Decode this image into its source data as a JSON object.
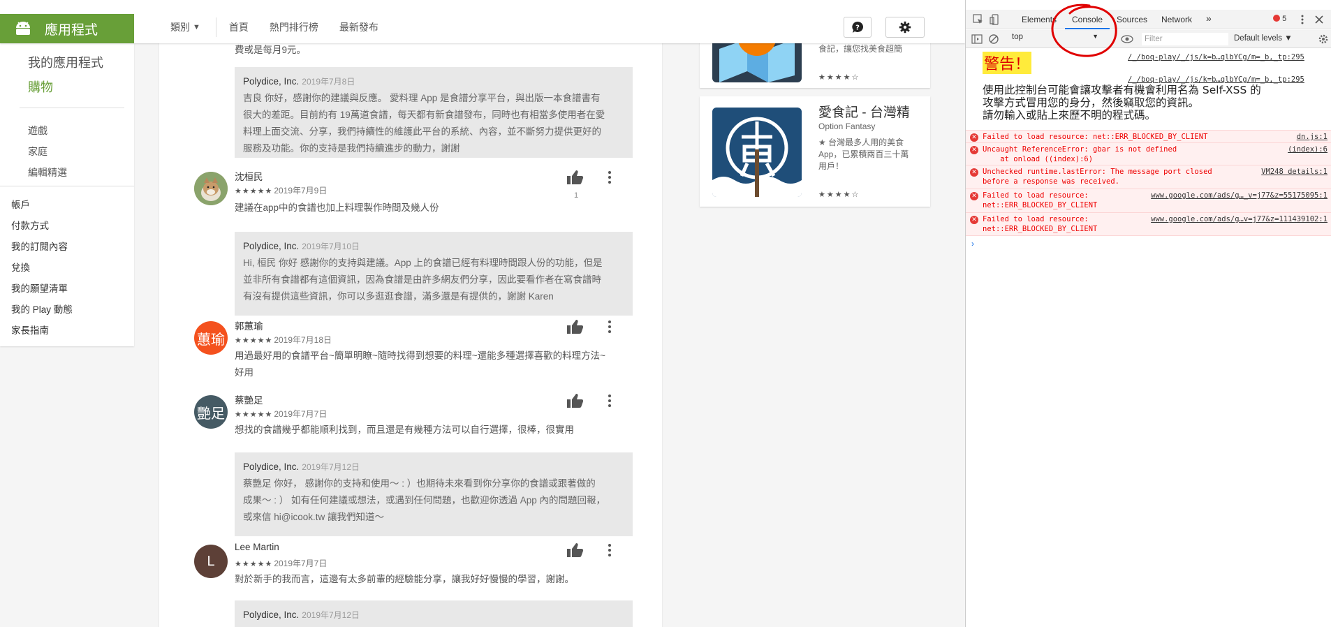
{
  "play": {
    "brand": "應用程式",
    "topnav": {
      "category": "類別",
      "home": "首頁",
      "top_charts": "熱門排行榜",
      "new_releases": "最新發布"
    },
    "sidenav": {
      "my_apps": "我的應用程式",
      "shop": "購物",
      "subs": [
        "遊戲",
        "家庭",
        "編輯精選"
      ],
      "account": [
        "帳戶",
        "付款方式",
        "我的訂閱內容",
        "兌換",
        "我的願望清單",
        "我的 Play 動態",
        "家長指南"
      ]
    },
    "top_fragment": "費或是每月9元。",
    "reviews": [
      {
        "reply_only": true,
        "reply": {
          "author": "Polydice, Inc.",
          "date": "2019年7月8日",
          "lines": [
            "吉良 你好，感謝你的建議與反應。 愛料理 App 是食譜分享平台，與出版一本食譜書有",
            "很大的差距。目前約有 19萬道食譜，每天都有新食譜發布，同時也有相當多使用者在愛",
            "料理上面交流、分享，我們持續性的維護此平台的系統、內容，並不斷努力提供更好的",
            "服務及功能。你的支持是我們持續進步的動力，謝謝"
          ]
        }
      },
      {
        "name": "沈桓民",
        "stars": "★★★★★",
        "date": "2019年7月9日",
        "likes": "1",
        "body": [
          "建議在app中的食譜也加上料理製作時間及幾人份"
        ],
        "reply": {
          "author": "Polydice, Inc.",
          "date": "2019年7月10日",
          "lines": [
            "Hi, 桓民 你好 感謝你的支持與建議。App 上的食譜已經有料理時間跟人份的功能，但是",
            "並非所有食譜都有這個資訊，因為食譜是由許多網友們分享，因此要看作者在寫食譜時",
            "有沒有提供這些資訊，你可以多逛逛食譜，滿多還是有提供的，謝謝 Karen"
          ]
        }
      },
      {
        "name": "郭蕙瑜",
        "avatar_text": "蕙瑜",
        "stars": "★★★★★",
        "date": "2019年7月18日",
        "body": [
          "用過最好用的食譜平台~簡單明瞭~隨時找得到想要的料理~還能多種選擇喜歡的料理方法~",
          "好用"
        ]
      },
      {
        "name": "蔡艷足",
        "avatar_text": "艷足",
        "stars": "★★★★★",
        "date": "2019年7月7日",
        "body": [
          "想找的食譜幾乎都能順利找到，而且還是有幾種方法可以自行選擇，很棒，很實用"
        ],
        "reply": {
          "author": "Polydice, Inc.",
          "date": "2019年7月12日",
          "lines": [
            "蔡艷足 你好， 感謝你的支持和使用～ : ）也期待未來看到你分享你的食譜或跟著做的",
            "成果～ : ） 如有任何建議或想法，或遇到任何問題，也歡迎你透過 App 內的問題回報，",
            "或來信 hi@icook.tw 讓我們知道～"
          ]
        }
      },
      {
        "name": "Lee Martin",
        "avatar_text": "L",
        "stars": "★★★★★",
        "date": "2019年7月7日",
        "body": [
          "對於新手的我而言，這邊有太多前輩的經驗能分享，讓我好好慢慢的學習，謝謝。"
        ],
        "reply": {
          "author": "Polydice, Inc.",
          "date": "2019年7月12日",
          "lines": []
        }
      }
    ],
    "apps": [
      {
        "desc_fragment": "食記，讓您找美食超簡",
        "stars": "★★★★☆"
      },
      {
        "title": "愛食記 - 台灣精",
        "developer": "Option Fantasy",
        "desc": [
          "★ 台灣最多人用的美食",
          "App，已累積兩百三十萬",
          "用戶！"
        ],
        "stars": "★★★★☆"
      }
    ]
  },
  "devtools": {
    "tabs": [
      "Elements",
      "Console",
      "Sources",
      "Network"
    ],
    "more_tabs": "»",
    "error_count": "5",
    "context": "top",
    "filter_placeholder": "Filter",
    "levels": "Default levels ▼",
    "warning_title": "警告！",
    "src1": "/_/boq-play/_/js/k=b…qlbYCg/m=_b,_tp:295",
    "src2": "/_/boq-play/_/js/k=b…qlbYCg/m=_b,_tp:295",
    "warning_lines": [
      "使用此控制台可能會讓攻擊者有機會利用名為 Self-XSS 的",
      "攻擊方式冒用您的身分，然後竊取您的資訊。",
      "請勿輸入或貼上來歷不明的程式碼。"
    ],
    "errors": [
      {
        "msg": "Failed to load resource: net::ERR_BLOCKED_BY_CLIENT",
        "loc": "dn.js:1"
      },
      {
        "msg": "Uncaught ReferenceError: gbar is not defined\n    at onload ((index):6)",
        "loc": "(index):6"
      },
      {
        "msg": "Unchecked runtime.lastError: The message port closed\nbefore a response was received.",
        "loc": "VM248 details:1"
      },
      {
        "msg": "Failed to load resource:\nnet::ERR_BLOCKED_BY_CLIENT",
        "loc": "www.google.com/ads/g…_v=j77&z=55175095:1"
      },
      {
        "msg": "Failed to load resource:\nnet::ERR_BLOCKED_BY_CLIENT",
        "loc": "www.google.com/ads/g…v=j77&z=111439102:1"
      }
    ],
    "prompt": "›"
  },
  "colors": {
    "play_green": "#689f38",
    "error_red": "#e00",
    "tab_blue": "#1a73e8",
    "annotation_red": "#e00000"
  }
}
